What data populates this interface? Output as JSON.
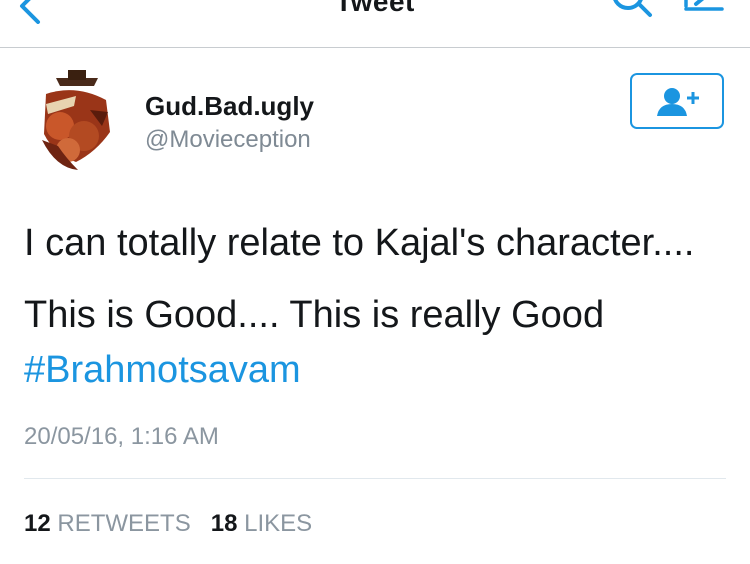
{
  "nav": {
    "title": "Tweet",
    "back_icon": "chevron-left-icon",
    "search_icon": "search-icon",
    "compose_icon": "compose-icon",
    "accent_color": "#1b95e0"
  },
  "author": {
    "display_name": "Gud.Bad.ugly",
    "handle": "@Movieception",
    "avatar_icon": "movie-poster-avatar"
  },
  "follow_button": {
    "icon": "add-user-icon",
    "color": "#1b95e0"
  },
  "tweet": {
    "line1": "I can totally relate to Kajal's character....",
    "line2": "This is Good.... This is really Good",
    "hashtag": "#Brahmotsavam",
    "timestamp": "20/05/16, 1:16 AM"
  },
  "stats": {
    "retweets_count": "12",
    "retweets_label": "RETWEETS",
    "likes_count": "18",
    "likes_label": "LIKES"
  }
}
